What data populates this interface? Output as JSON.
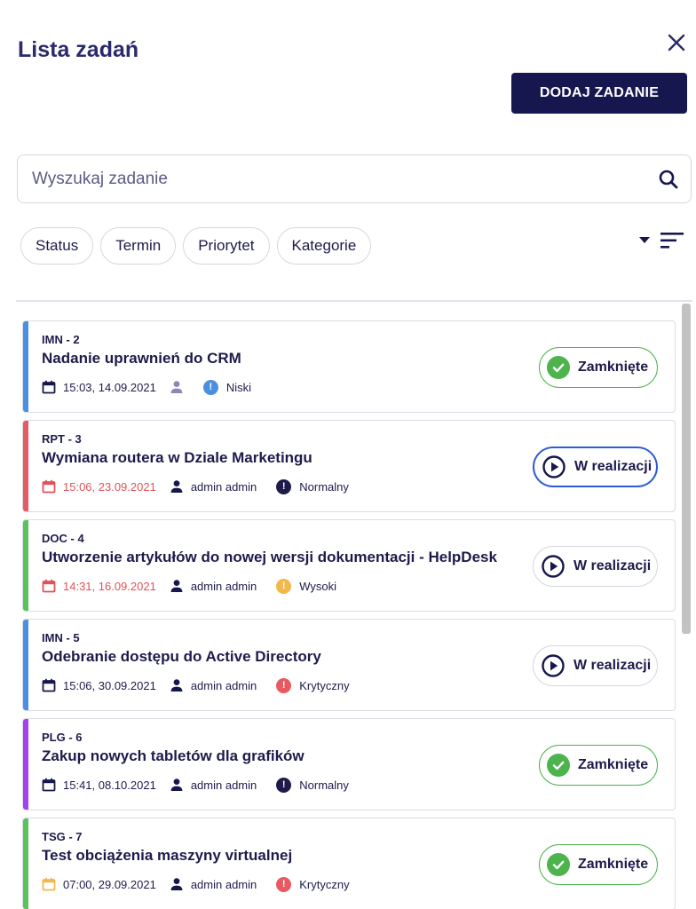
{
  "header": {
    "title": "Lista zadań",
    "add_label": "DODAJ ZADANIE"
  },
  "search": {
    "placeholder": "Wyszukaj zadanie",
    "value": ""
  },
  "filters": [
    "Status",
    "Termin",
    "Priorytet",
    "Kategorie"
  ],
  "colors": {
    "accent_blue": "#4a90e2",
    "accent_red": "#e85a62",
    "accent_green": "#5ac25a",
    "accent_purple": "#a341f0",
    "priority_low": "#4a90e2",
    "priority_normal": "#1e1b4b",
    "priority_high": "#f2b84b",
    "priority_critical": "#e85a62",
    "status_closed": "#4cb34d"
  },
  "tasks": [
    {
      "code": "IMN - 2",
      "title": "Nadanie uprawnień do CRM",
      "date": "15:03, 14.09.2021",
      "date_overdue": false,
      "user": "",
      "priority": "Niski",
      "priority_color": "#4a90e2",
      "accent": "#4a90e2",
      "status": "Zamknięte",
      "status_type": "closed",
      "status_active": false
    },
    {
      "code": "RPT - 3",
      "title": "Wymiana routera w Dziale Marketingu",
      "date": "15:06, 23.09.2021",
      "date_overdue": true,
      "user": "admin admin",
      "priority": "Normalny",
      "priority_color": "#1e1b4b",
      "accent": "#e85a62",
      "status": "W realizacji",
      "status_type": "progress",
      "status_active": true
    },
    {
      "code": "DOC - 4",
      "title": "Utworzenie artykułów do nowej wersji dokumentacji - HelpDesk",
      "date": "14:31, 16.09.2021",
      "date_overdue": true,
      "user": "admin admin",
      "priority": "Wysoki",
      "priority_color": "#f2b84b",
      "accent": "#5ac25a",
      "status": "W realizacji",
      "status_type": "progress",
      "status_active": false
    },
    {
      "code": "IMN - 5",
      "title": "Odebranie dostępu do Active Directory",
      "date": "15:06, 30.09.2021",
      "date_overdue": false,
      "user": "admin admin",
      "priority": "Krytyczny",
      "priority_color": "#e85a62",
      "accent": "#4a90e2",
      "status": "W realizacji",
      "status_type": "progress",
      "status_active": false
    },
    {
      "code": "PLG - 6",
      "title": "Zakup nowych tabletów dla grafików",
      "date": "15:41, 08.10.2021",
      "date_overdue": false,
      "user": "admin admin",
      "priority": "Normalny",
      "priority_color": "#1e1b4b",
      "accent": "#a341f0",
      "status": "Zamknięte",
      "status_type": "closed",
      "status_active": false
    },
    {
      "code": "TSG - 7",
      "title": "Test obciążenia maszyny virtualnej",
      "date": "07:00, 29.09.2021",
      "date_overdue": false,
      "user": "admin admin",
      "priority": "Krytyczny",
      "priority_color": "#e85a62",
      "accent": "#5ac25a",
      "status": "Zamknięte",
      "status_type": "closed",
      "status_active": false,
      "calendar_color": "#f2b84b"
    }
  ]
}
